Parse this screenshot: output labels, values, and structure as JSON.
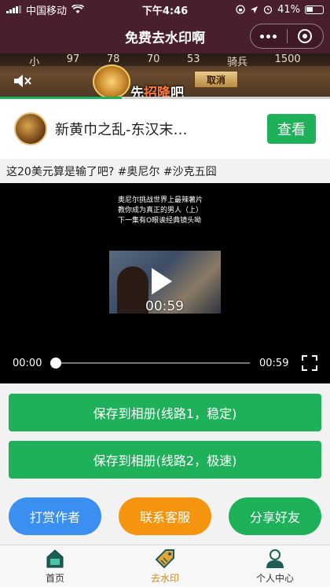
{
  "status_bar": {
    "carrier": "中国移动",
    "time": "下午4:46",
    "battery": "41%"
  },
  "nav": {
    "title": "免费去水印啊"
  },
  "ad": {
    "stats": [
      "小",
      "97",
      "78",
      "70",
      "53",
      "骑兵",
      "1500"
    ],
    "caption_pre": "先",
    "caption_highlight": "招降",
    "caption_post": "吧",
    "button_label": "取消",
    "progress": 0.37
  },
  "game_card": {
    "title": "新黄巾之乱-东汉末…",
    "view_label": "查看"
  },
  "post": {
    "caption": "这20美元算是输了吧? #奥尼尔 #沙克五囧"
  },
  "video": {
    "subtitle_lines": [
      "奥尼尔挑战世界上最辣薯片",
      "教你成为真正的男人（上）",
      "下一集有O眼诶经典镜头呦"
    ],
    "duration_center": "00:59",
    "time_current": "00:00",
    "time_total": "00:59",
    "progress": 0
  },
  "actions": {
    "save_line1": "保存到相册(线路1，稳定)",
    "save_line2": "保存到相册(线路2，极速)",
    "tip_author": "打赏作者",
    "contact_service": "联系客服",
    "share_friends": "分享好友"
  },
  "colors": {
    "nav_bg": "#4a1f2d",
    "green": "#1fb05a",
    "blue": "#3a8ff0",
    "orange": "#f5940f",
    "active_tab": "#d08a1c"
  },
  "tabs": [
    {
      "label": "首页",
      "icon": "home-icon",
      "active": false
    },
    {
      "label": "去水印",
      "icon": "tag-icon",
      "active": true
    },
    {
      "label": "个人中心",
      "icon": "person-icon",
      "active": false
    }
  ]
}
